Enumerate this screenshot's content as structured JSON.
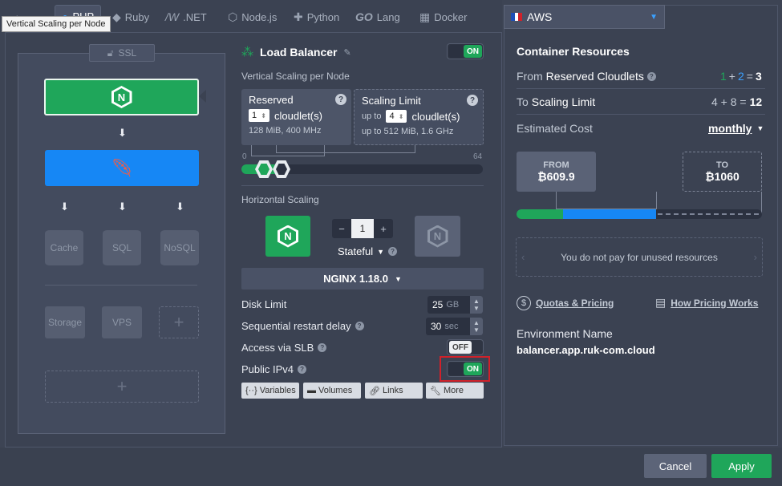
{
  "tooltip": "Vertical Scaling per Node",
  "tabs": [
    {
      "label": "PHP",
      "icon": "php-icon"
    },
    {
      "label": "Ruby",
      "icon": "ruby-icon"
    },
    {
      "label": ".NET",
      "icon": "dotnet-icon"
    },
    {
      "label": "Node.js",
      "icon": "nodejs-icon"
    },
    {
      "label": "Python",
      "icon": "python-icon"
    },
    {
      "label": "Lang",
      "icon": "go-icon"
    },
    {
      "label": "Docker",
      "icon": "docker-icon"
    }
  ],
  "topology": {
    "ssl_label": "SSL",
    "db_nodes": [
      "Cache",
      "SQL",
      "NoSQL"
    ],
    "storage_nodes": [
      "Storage",
      "VPS"
    ],
    "add_symbol": "+"
  },
  "node": {
    "title": "Load Balancer",
    "on_label": "ON",
    "vertical_title": "Vertical Scaling per Node",
    "reserved": {
      "label": "Reserved",
      "value": "1",
      "unit": "cloudlet(s)",
      "spec": "128 MiB, 400 MHz"
    },
    "limit": {
      "label": "Scaling Limit",
      "prefix": "up to",
      "value": "4",
      "unit": "cloudlet(s)",
      "spec_prefix": "up to",
      "spec": "512 MiB, 1.6 GHz"
    },
    "scale_min": "0",
    "scale_max": "64",
    "horizontal_title": "Horizontal Scaling",
    "count": "1",
    "mode": "Stateful",
    "version": "NGINX 1.18.0",
    "disk_label": "Disk Limit",
    "disk_value": "25",
    "disk_unit": "GB",
    "restart_label": "Sequential restart delay",
    "restart_value": "30",
    "restart_unit": "sec",
    "slb_label": "Access via SLB",
    "slb_state": "OFF",
    "ipv4_label": "Public IPv4",
    "ipv4_state": "ON",
    "buttons": [
      "Variables",
      "Volumes",
      "Links",
      "More"
    ]
  },
  "region": {
    "name": "AWS",
    "flag": "flag-icon"
  },
  "resources": {
    "title": "Container Resources",
    "reserved_label_pre": "From",
    "reserved_label": "Reserved Cloudlets",
    "reserved_a": "1",
    "reserved_plus": "+",
    "reserved_b": "2",
    "reserved_eq": "=",
    "reserved_total": "3",
    "limit_label_pre": "To",
    "limit_label": "Scaling Limit",
    "limit_expr": "4 + 8 =",
    "limit_total": "12",
    "cost_label": "Estimated Cost",
    "cost_period": "monthly",
    "from_label": "FROM",
    "from_value": "₿609.9",
    "to_label": "TO",
    "to_value": "₿1060",
    "cost_bar": {
      "green": 0.19,
      "blue": 0.38,
      "accent_green": "#1fa65a",
      "accent_blue": "#1687f5"
    },
    "unused_note": "You do not pay for unused resources",
    "quotas_link": "Quotas & Pricing",
    "pricing_link": "How Pricing Works",
    "env_label": "Environment Name",
    "env_value": "balancer.app.ruk-com.cloud"
  },
  "footer": {
    "cancel": "Cancel",
    "apply": "Apply"
  },
  "colors": {
    "green": "#1fa65a",
    "blue": "#1687f5",
    "highlight": "#d0212a"
  }
}
